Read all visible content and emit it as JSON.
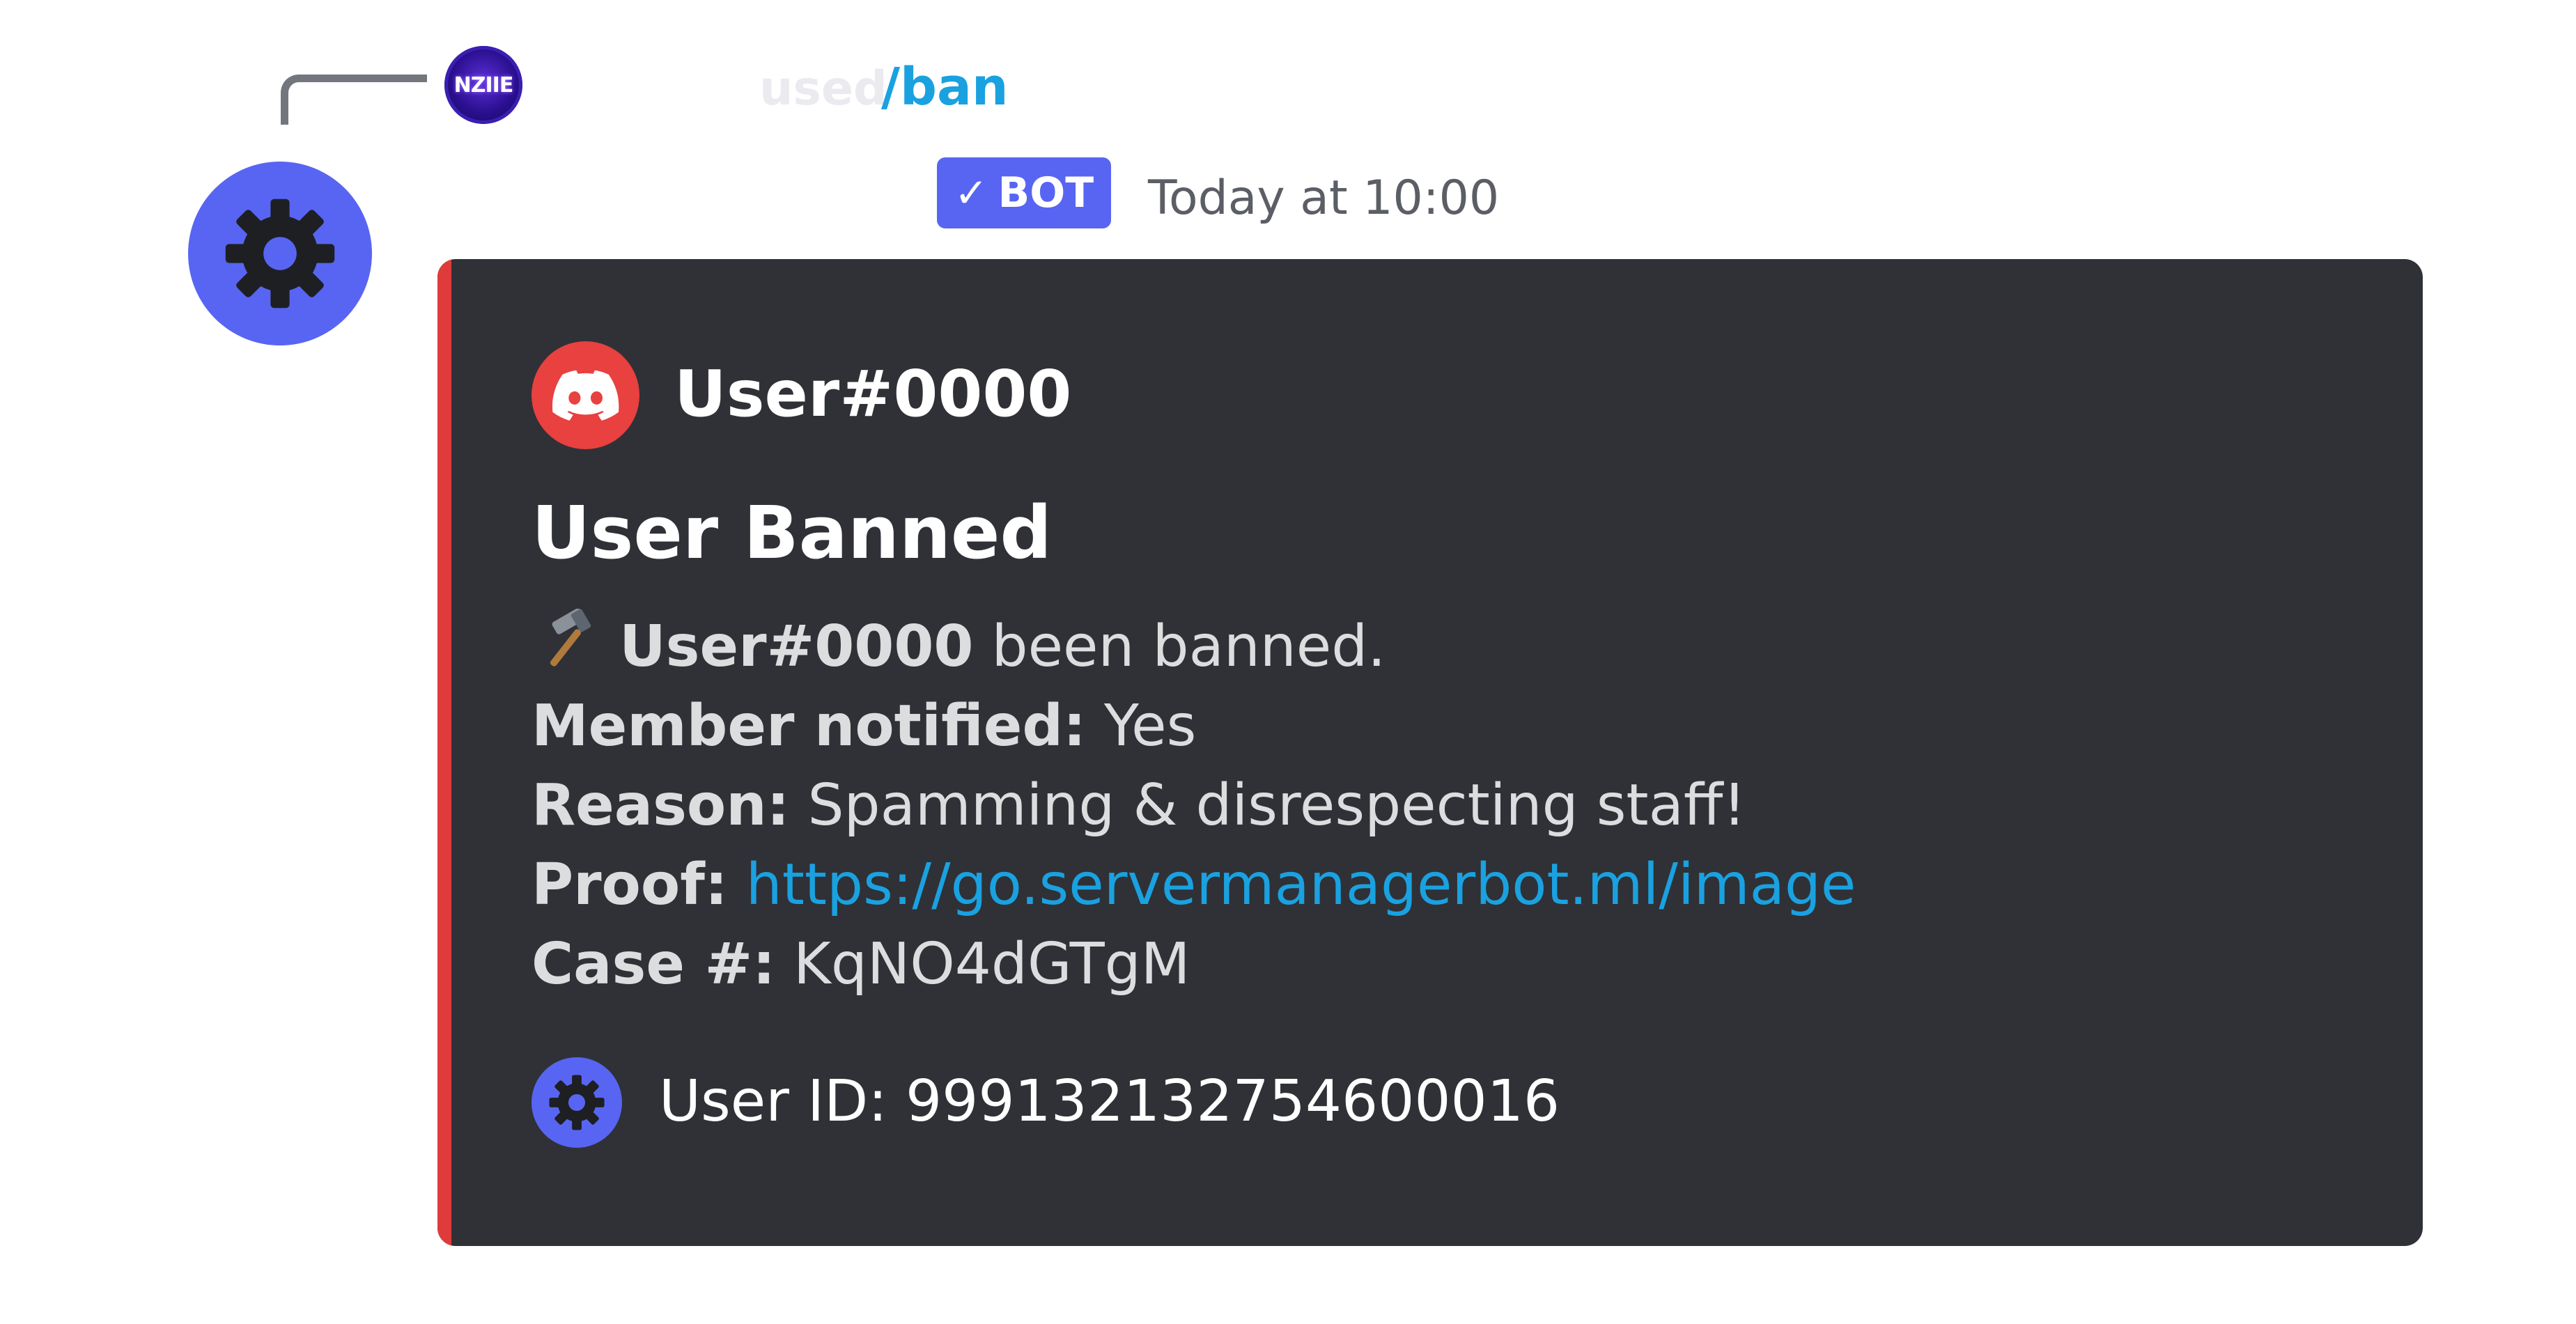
{
  "reply": {
    "avatar_label": "NZIIE",
    "action_text": "used",
    "command": "/ban"
  },
  "message": {
    "bot_badge": "BOT",
    "timestamp": "Today at 10:00"
  },
  "embed": {
    "accent_color": "#e03b3b",
    "author_name": "User#0000",
    "author_icon": "discord-logo-icon",
    "title": "User Banned",
    "description": {
      "emoji": "hammer-icon",
      "subject": "User#0000",
      "action": " been banned.",
      "fields": [
        {
          "label": "Member notified:",
          "value": " Yes"
        },
        {
          "label": "Reason:",
          "value": " Spamming & disrespecting staff!"
        },
        {
          "label": "Proof:",
          "value": " https://go.servermanagerbot.ml/image"
        },
        {
          "label": "Case #:",
          "value": " KqNO4dGTgM"
        }
      ]
    },
    "footer_text": "User ID: 999132132754600016"
  },
  "colors": {
    "bot_blurple": "#5865f2",
    "embed_background": "#2f3136",
    "link": "#1aa1e0"
  }
}
